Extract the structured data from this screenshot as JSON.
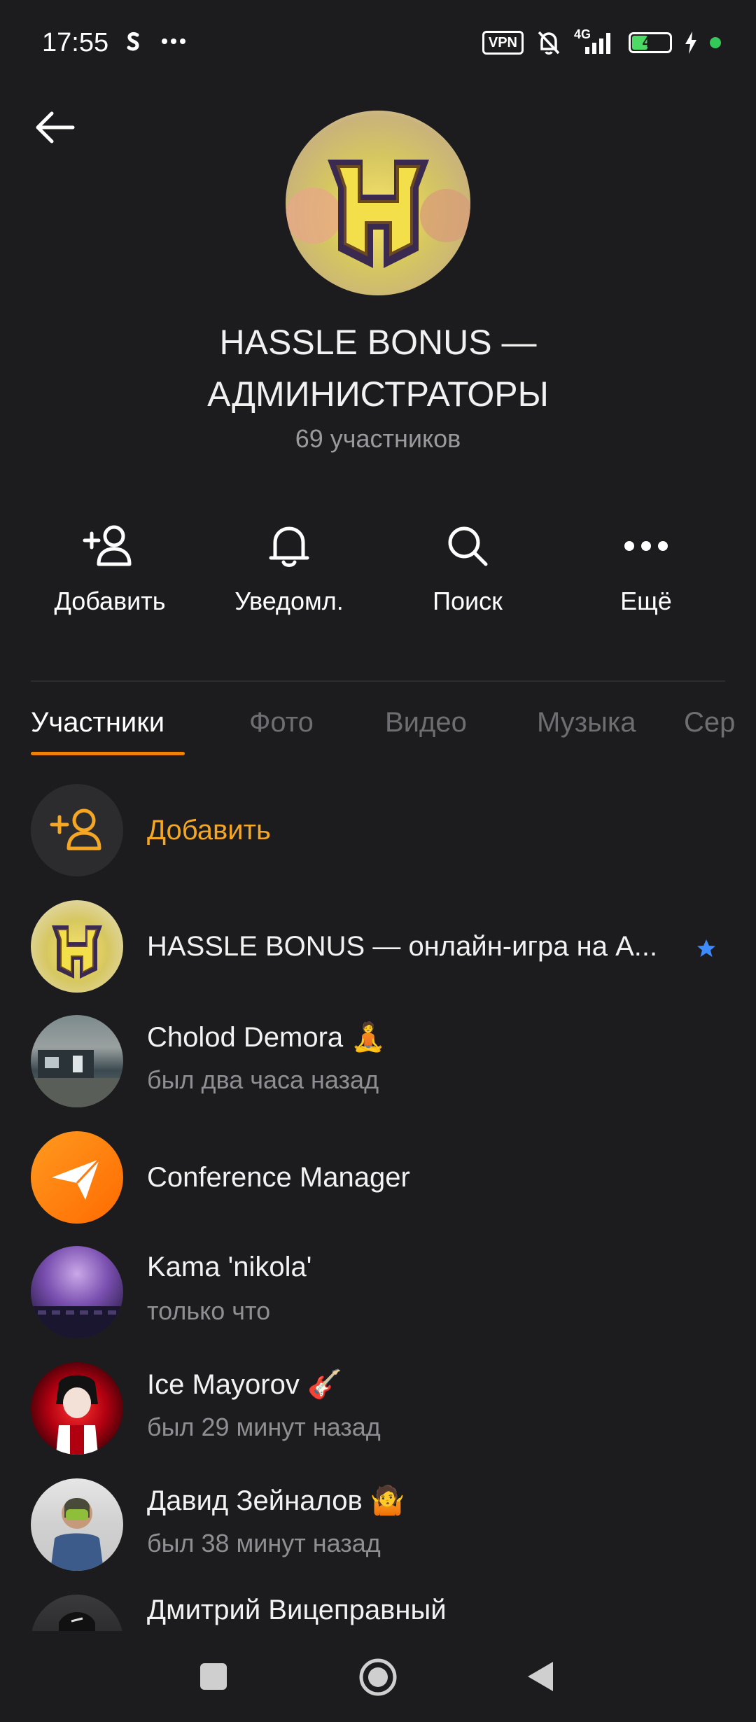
{
  "status_bar": {
    "time": "17:55",
    "vpn": "VPN",
    "network": "4G",
    "battery_level": "42",
    "battery_fraction": 0.42,
    "icons": [
      "shazam-icon",
      "more-dots-icon",
      "vpn-icon",
      "bell-muted-icon",
      "signal-icon",
      "battery-icon",
      "charging-icon",
      "green-dot-icon"
    ]
  },
  "header": {
    "title_line1": "HASSLE BONUS —",
    "title_line2": "АДМИНИСТРАТОРЫ",
    "members_count": "69 участников"
  },
  "actions": [
    {
      "label": "Добавить",
      "icon": "add-user-icon"
    },
    {
      "label": "Уведомл.",
      "icon": "bell-icon"
    },
    {
      "label": "Поиск",
      "icon": "search-icon"
    },
    {
      "label": "Ещё",
      "icon": "more-icon"
    }
  ],
  "tabs": [
    {
      "label": "Участники",
      "active": true
    },
    {
      "label": "Фото",
      "active": false
    },
    {
      "label": "Видео",
      "active": false
    },
    {
      "label": "Музыка",
      "active": false
    },
    {
      "label": "Сер",
      "active": false
    }
  ],
  "add_member": {
    "label": "Добавить"
  },
  "members": [
    {
      "name": "HASSLE BONUS — онлайн-игра на А...",
      "status": "",
      "badge": "star-icon"
    },
    {
      "name": "Cholod Demora 🧘",
      "status": "был два часа назад"
    },
    {
      "name": "Conference Manager",
      "status": ""
    },
    {
      "name": "Kama 'nikola'",
      "status": "только что"
    },
    {
      "name": "Ice Mayorov 🎸",
      "status": "был 29 минут назад"
    },
    {
      "name": "Давид Зейналов 🤷",
      "status": "был 38 минут назад"
    },
    {
      "name": "Дмитрий Вицеправный",
      "status": ""
    }
  ],
  "colors": {
    "background": "#1c1c1e",
    "accent": "#ee8208",
    "add_text": "#f5a623",
    "muted": "#8e8e93",
    "star": "#3d8bff"
  }
}
